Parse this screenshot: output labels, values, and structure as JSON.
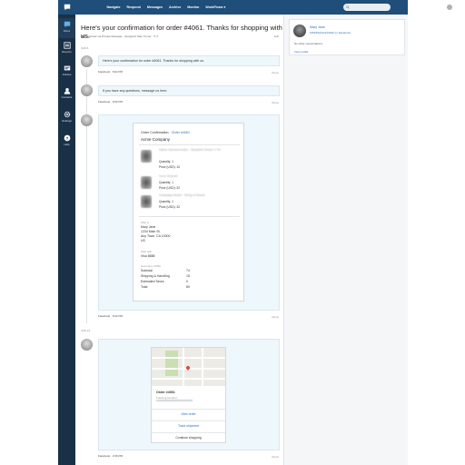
{
  "topbar": {
    "nav": [
      "Navigate",
      "Respond",
      "Messages",
      "Archive",
      "Monitor",
      "WorkFlows ▾"
    ],
    "search_placeholder": ""
  },
  "sidebar": {
    "items": [
      {
        "label": "Inbox",
        "icon": "chat-bubble-icon"
      },
      {
        "label": "Reports",
        "icon": "reports-icon"
      },
      {
        "label": "Articles",
        "icon": "articles-icon"
      },
      {
        "label": "Contacts",
        "icon": "contacts-icon"
      },
      {
        "label": "Settings",
        "icon": "gear-icon"
      },
      {
        "label": "Help",
        "icon": "help-icon"
      }
    ]
  },
  "conversation": {
    "title": "Here's your confirmation for order #4061. Thanks for shopping with us.",
    "subline": "Facebook via Private Message · Assigned: Mae Turner · ✎ ▾",
    "edit_label": "Edit",
    "date1": "JUN 6",
    "msg1": "Here's your confirmation for order #4061. Thanks for shopping with us.",
    "meta1": "Facebook · 6:02 PM",
    "msg2": "If you have any questions, message us here.",
    "meta2": "Facebook · 6:02 PM",
    "meta3": "Facebook · 6:02 PM",
    "date2": "JUN 13",
    "meta4": "Facebook · 2:36 PM",
    "reply_label": "Reply"
  },
  "receipt": {
    "heading": "Order Confirmation · ",
    "order_link": "Order #4061",
    "company": "Acme Company",
    "items": [
      {
        "name": "Native Samsonvoides · Stracketh Dream 2 Yrs",
        "qty": "Quantity: 1",
        "price": "Price (USD): 10"
      },
      {
        "name": "Huon Sheesle",
        "qty": "Quantity: 1",
        "price": "Price (USD): 32"
      },
      {
        "name": "Campaign Model · String of Hearts",
        "qty": "Quantity: 1",
        "price": "Price (USD): 32"
      }
    ],
    "ship_label": "Ship to",
    "ship_name": "Mary Jane",
    "ship_street": "1234 Main St.",
    "ship_city": "Any Town, CA 10000",
    "ship_country": "US",
    "paid_label": "Paid with",
    "paid_value": "Visa 8888",
    "summary_label": "Summary (USD)",
    "summary": [
      {
        "label": "Subtotal",
        "value": "74"
      },
      {
        "label": "Shipping & Handling",
        "value": "15"
      },
      {
        "label": "Estimated Taxes",
        "value": "0"
      },
      {
        "label": "Total",
        "value": "89"
      }
    ]
  },
  "order_card": {
    "title": "Order #4061",
    "tracking_label": "Tracking Number:",
    "buttons": [
      "View order",
      "Track shipment",
      "Continue shopping"
    ]
  },
  "profile": {
    "name": "Mary Jane",
    "id_text": "1652462143123232 on Facebook",
    "note": "No other conversations",
    "link": "View profile"
  }
}
